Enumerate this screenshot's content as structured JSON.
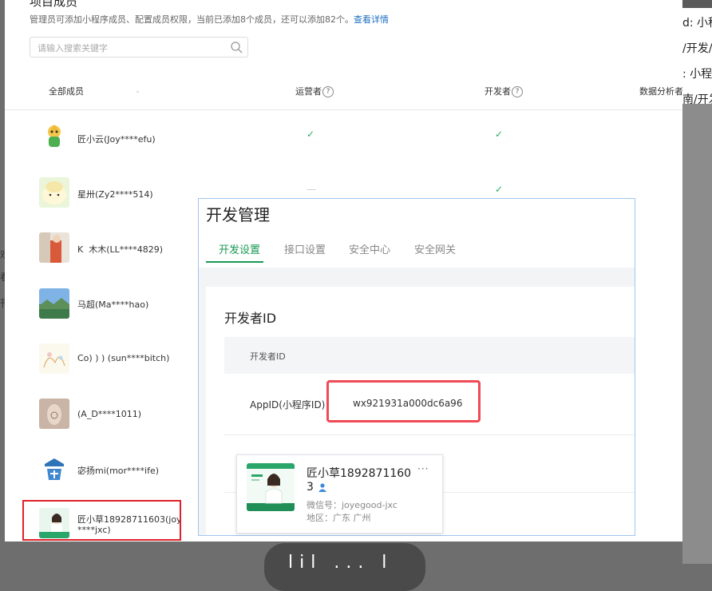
{
  "panel": {
    "title": "项目成员",
    "description": "管理员可添加小程序成员、配置成员权限，当前已添加8个成员，还可以添加82个。",
    "details_link": "查看详情"
  },
  "search": {
    "placeholder": "请输入搜索关键字"
  },
  "table": {
    "columns": [
      "全部成员",
      "运营者",
      "开发者",
      "数据分析者"
    ]
  },
  "members": [
    {
      "name": "匠小云(Joy****efu)",
      "operator": "check",
      "developer": "check"
    },
    {
      "name": "星卅(Zy2****514)",
      "operator": "dash",
      "developer": "check"
    },
    {
      "name": "K ︎ 木木(LL****4829)"
    },
    {
      "name": "马超(Ma****hao)"
    },
    {
      "name": "Co) ) ) (sun****bitch)"
    },
    {
      "name": "(A_D****1011)"
    },
    {
      "name": "宓扬mi(mor****ife)"
    },
    {
      "name_line1": "匠小草18928711603(joy",
      "name_line2": "****jxc)"
    }
  ],
  "dev_panel": {
    "title": "开发管理",
    "tabs": [
      "开发设置",
      "接口设置",
      "安全中心",
      "安全网关"
    ],
    "section_title": "开发者ID",
    "header_label": "开发者ID",
    "appid_label": "AppID(小程序ID)",
    "appid_value": "wx921931a000dc6a96"
  },
  "profile_card": {
    "name_line1": "匠小草1892871160",
    "name_line2": "3",
    "more": "···",
    "wechat_line": "微信号：joyegood-jxc",
    "region_line": "地区：广东 广州"
  },
  "right_fragments": [
    "d: 小程",
    "/开发/",
    ": 小程",
    "南/开发"
  ],
  "left_fragments": [
    "欢",
    "看",
    "刊"
  ],
  "dock_text": "lil ... l",
  "colors": {
    "accent_green": "#1a9954",
    "check_green": "#2aae67",
    "link_blue": "#1f6fc0",
    "highlight_red": "#e0212a"
  }
}
